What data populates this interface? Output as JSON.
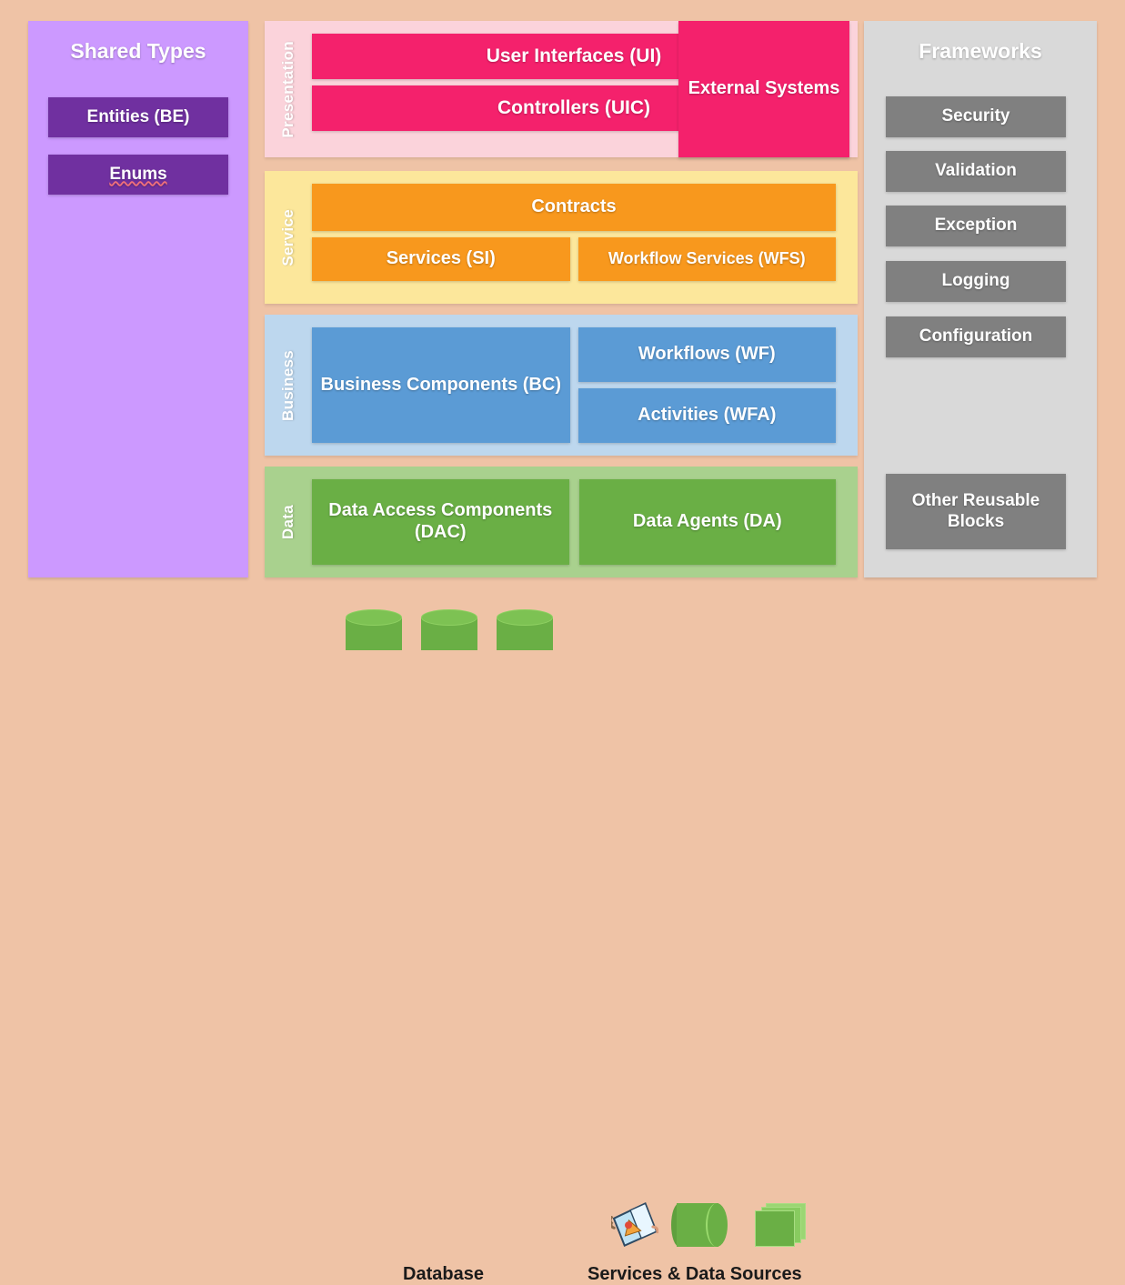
{
  "diagram": {
    "background_color": "#EFC3A6",
    "shared_types": {
      "title": "Shared Types",
      "panel_color": "#CC99FF",
      "chip_color": "#7030A0",
      "items": [
        {
          "label": "Entities (BE)"
        },
        {
          "label": "Enums"
        }
      ]
    },
    "layers": [
      {
        "name": "Presentation",
        "band_color": "#FBD3DB",
        "box_color": "#F4216C",
        "boxes": [
          {
            "label": "User Interfaces (UI)"
          },
          {
            "label": "Controllers (UIC)"
          }
        ]
      },
      {
        "name": "Service",
        "band_color": "#FCE79B",
        "box_color": "#F8981D",
        "boxes": [
          {
            "label": "Contracts"
          },
          {
            "label": "Services (SI)"
          },
          {
            "label": "Workflow Services (WFS)"
          }
        ]
      },
      {
        "name": "Business",
        "band_color": "#BDD7EE",
        "box_color": "#5B9BD5",
        "boxes": [
          {
            "label": "Business Components (BC)"
          },
          {
            "label": "Workflows (WF)"
          },
          {
            "label": "Activities (WFA)"
          }
        ]
      },
      {
        "name": "Data",
        "band_color": "#A9D18E",
        "box_color": "#6AAF45",
        "boxes": [
          {
            "label": "Data Access Components (DAC)"
          },
          {
            "label": "Data Agents (DA)"
          }
        ]
      }
    ],
    "external_systems": {
      "label": "External Systems",
      "color": "#F4216C"
    },
    "frameworks": {
      "title": "Frameworks",
      "panel_color": "#D9D9D9",
      "chip_color": "#808080",
      "items": [
        {
          "label": "Security"
        },
        {
          "label": "Validation"
        },
        {
          "label": "Exception"
        },
        {
          "label": "Logging"
        },
        {
          "label": "Configuration"
        }
      ],
      "other": {
        "label": "Other Reusable Blocks"
      }
    },
    "bottom": {
      "database_label": "Database",
      "services_sources_label": "Services & Data Sources",
      "icon_color": "#6AAF45"
    }
  }
}
